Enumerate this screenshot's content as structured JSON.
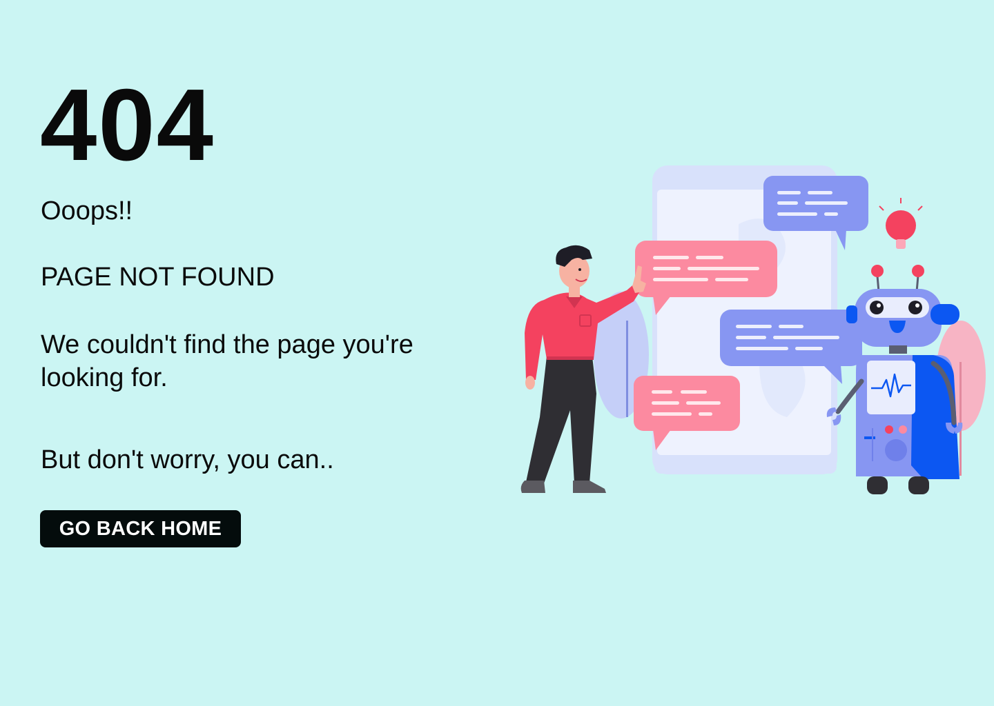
{
  "error": {
    "code": "404",
    "exclamation": "Ooops!!",
    "title": "PAGE NOT FOUND",
    "message": "We couldn't find the page you're looking for.",
    "reassurance": "But don't worry, you can.."
  },
  "actions": {
    "home_label": "GO BACK HOME"
  },
  "colors": {
    "background": "#cbf5f3",
    "button": "#040c0c",
    "accent_red": "#f4425f",
    "accent_blue": "#8796f2",
    "robot_blue": "#0c57f2"
  },
  "illustration": {
    "icon": "person-and-robot-chat-illustration"
  }
}
